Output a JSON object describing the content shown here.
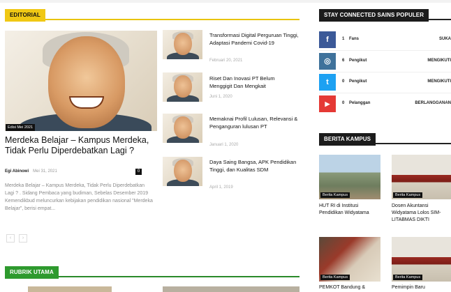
{
  "editorial": {
    "section_label": "EDITORIAL",
    "featured": {
      "badge": "Edisi Mei 2021",
      "title": "Merdeka Belajar – Kampus Merdeka, Tidak Perlu Diperdebatkan Lagi ?",
      "author": "Egi Abinowi",
      "date": "Mei 31, 2021",
      "comments": "0",
      "excerpt": "Merdeka Belajar – Kampus Merdeka, Tidak Perlu Diperdebatkan Lagi ? . Sidang Pembaca yang budiman,       Sebelas Desember 2019 Kemendikbud meluncurkan kebijakan pendidikan nasional \"Merdeka Belajar\", berisi empat...",
      "prev": "‹",
      "next": "›"
    },
    "list": [
      {
        "title": "Transformasi Digital Perguruan Tinggi, Adaptasi Pandemi Covid-19",
        "date": "Februari 20, 2021"
      },
      {
        "title": "Riset Dan Inovasi PT Belum Menggigit Dan Mengkait",
        "date": "Juni 1, 2020"
      },
      {
        "title": "Memaknai Profil Lulusan, Relevansi & Penganguran lulusan PT",
        "date": "Januari 1, 2020"
      },
      {
        "title": "Daya Saing Bangsa, APK Pendidikan Tinggi, dan Kualitas SDM",
        "date": "April 1, 2019"
      }
    ]
  },
  "rubrik": {
    "section_label": "RUBRIK UTAMA"
  },
  "social": {
    "section_label": "STAY CONNECTED SAINS POPULER",
    "rows": [
      {
        "icon": "f",
        "count": "1",
        "unit": "Fans",
        "action": "SUKA",
        "color": "#3b5998"
      },
      {
        "icon": "◎",
        "count": "6",
        "unit": "Pengikut",
        "action": "MENGIKUTI",
        "color": "#3f729b"
      },
      {
        "icon": "t",
        "count": "0",
        "unit": "Pengikut",
        "action": "MENGIKUTI",
        "color": "#1da1f2"
      },
      {
        "icon": "▶",
        "count": "0",
        "unit": "Pelanggan",
        "action": "BERLANGGANAN",
        "color": "#e53935"
      }
    ]
  },
  "berita": {
    "section_label": "BERITA KAMPUS",
    "items": [
      {
        "label": "Berita Kampus",
        "title": "HUT RI di Institusi Pendidikan Widyatama"
      },
      {
        "label": "Berita Kampus",
        "title": "Dosen Akuntansi Widyatama Lolos SIM-LITABMAS DIKTI"
      },
      {
        "label": "Berita Kampus",
        "title": "PEMKOT Bandung &"
      },
      {
        "label": "Berita Kampus",
        "title": "Pemimpin Baru"
      }
    ]
  }
}
